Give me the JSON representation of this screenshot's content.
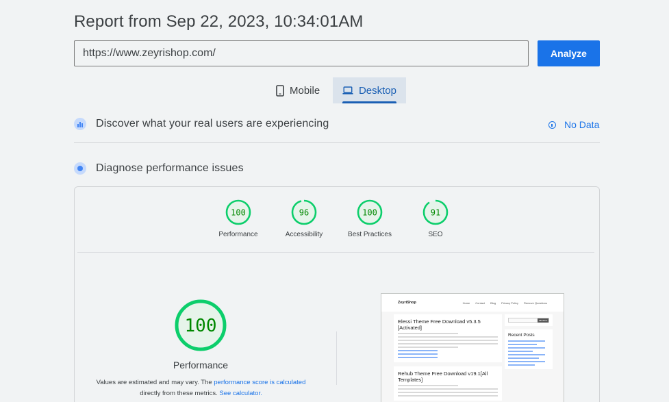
{
  "report": {
    "title": "Report from Sep 22, 2023, 10:34:01AM"
  },
  "url_bar": {
    "value": "https://www.zeyrishop.com/",
    "analyze_label": "Analyze"
  },
  "tabs": [
    {
      "label": "Mobile",
      "icon": "smartphone-icon",
      "selected": false
    },
    {
      "label": "Desktop",
      "icon": "laptop-icon",
      "selected": true
    }
  ],
  "field_data": {
    "heading": "Discover what your real users are experiencing",
    "status": "No Data"
  },
  "lab_data": {
    "heading": "Diagnose performance issues"
  },
  "scores": [
    {
      "label": "Performance",
      "value": "100",
      "fraction": 1.0
    },
    {
      "label": "Accessibility",
      "value": "96",
      "fraction": 0.96
    },
    {
      "label": "Best Practices",
      "value": "100",
      "fraction": 1.0
    },
    {
      "label": "SEO",
      "value": "91",
      "fraction": 0.91
    }
  ],
  "main_score": {
    "value": "100",
    "label": "Performance",
    "fraction": 1.0
  },
  "note": {
    "text1": "Values are estimated and may vary. The ",
    "link1": "performance score is calculated",
    "text2": " directly from these metrics. ",
    "link2": "See calculator."
  },
  "screenshot": {
    "brand": "ZeyriShop",
    "nav": [
      "Home",
      "Contact",
      "Blog",
      "Privacy Policy",
      "Remove Questions"
    ],
    "post1_title": "Elessi Theme Free Download v5.3.5 [Activated]",
    "post2_title": "Rehub Theme Free Download v19.1[All Templates]",
    "search_button": "SEARCH",
    "recent_posts_title": "Recent Posts"
  },
  "colors": {
    "accent": "#1a73e8",
    "score_good": "#0cce6b",
    "score_good_text": "#008800",
    "score_good_bg": "#e6f4ea"
  }
}
